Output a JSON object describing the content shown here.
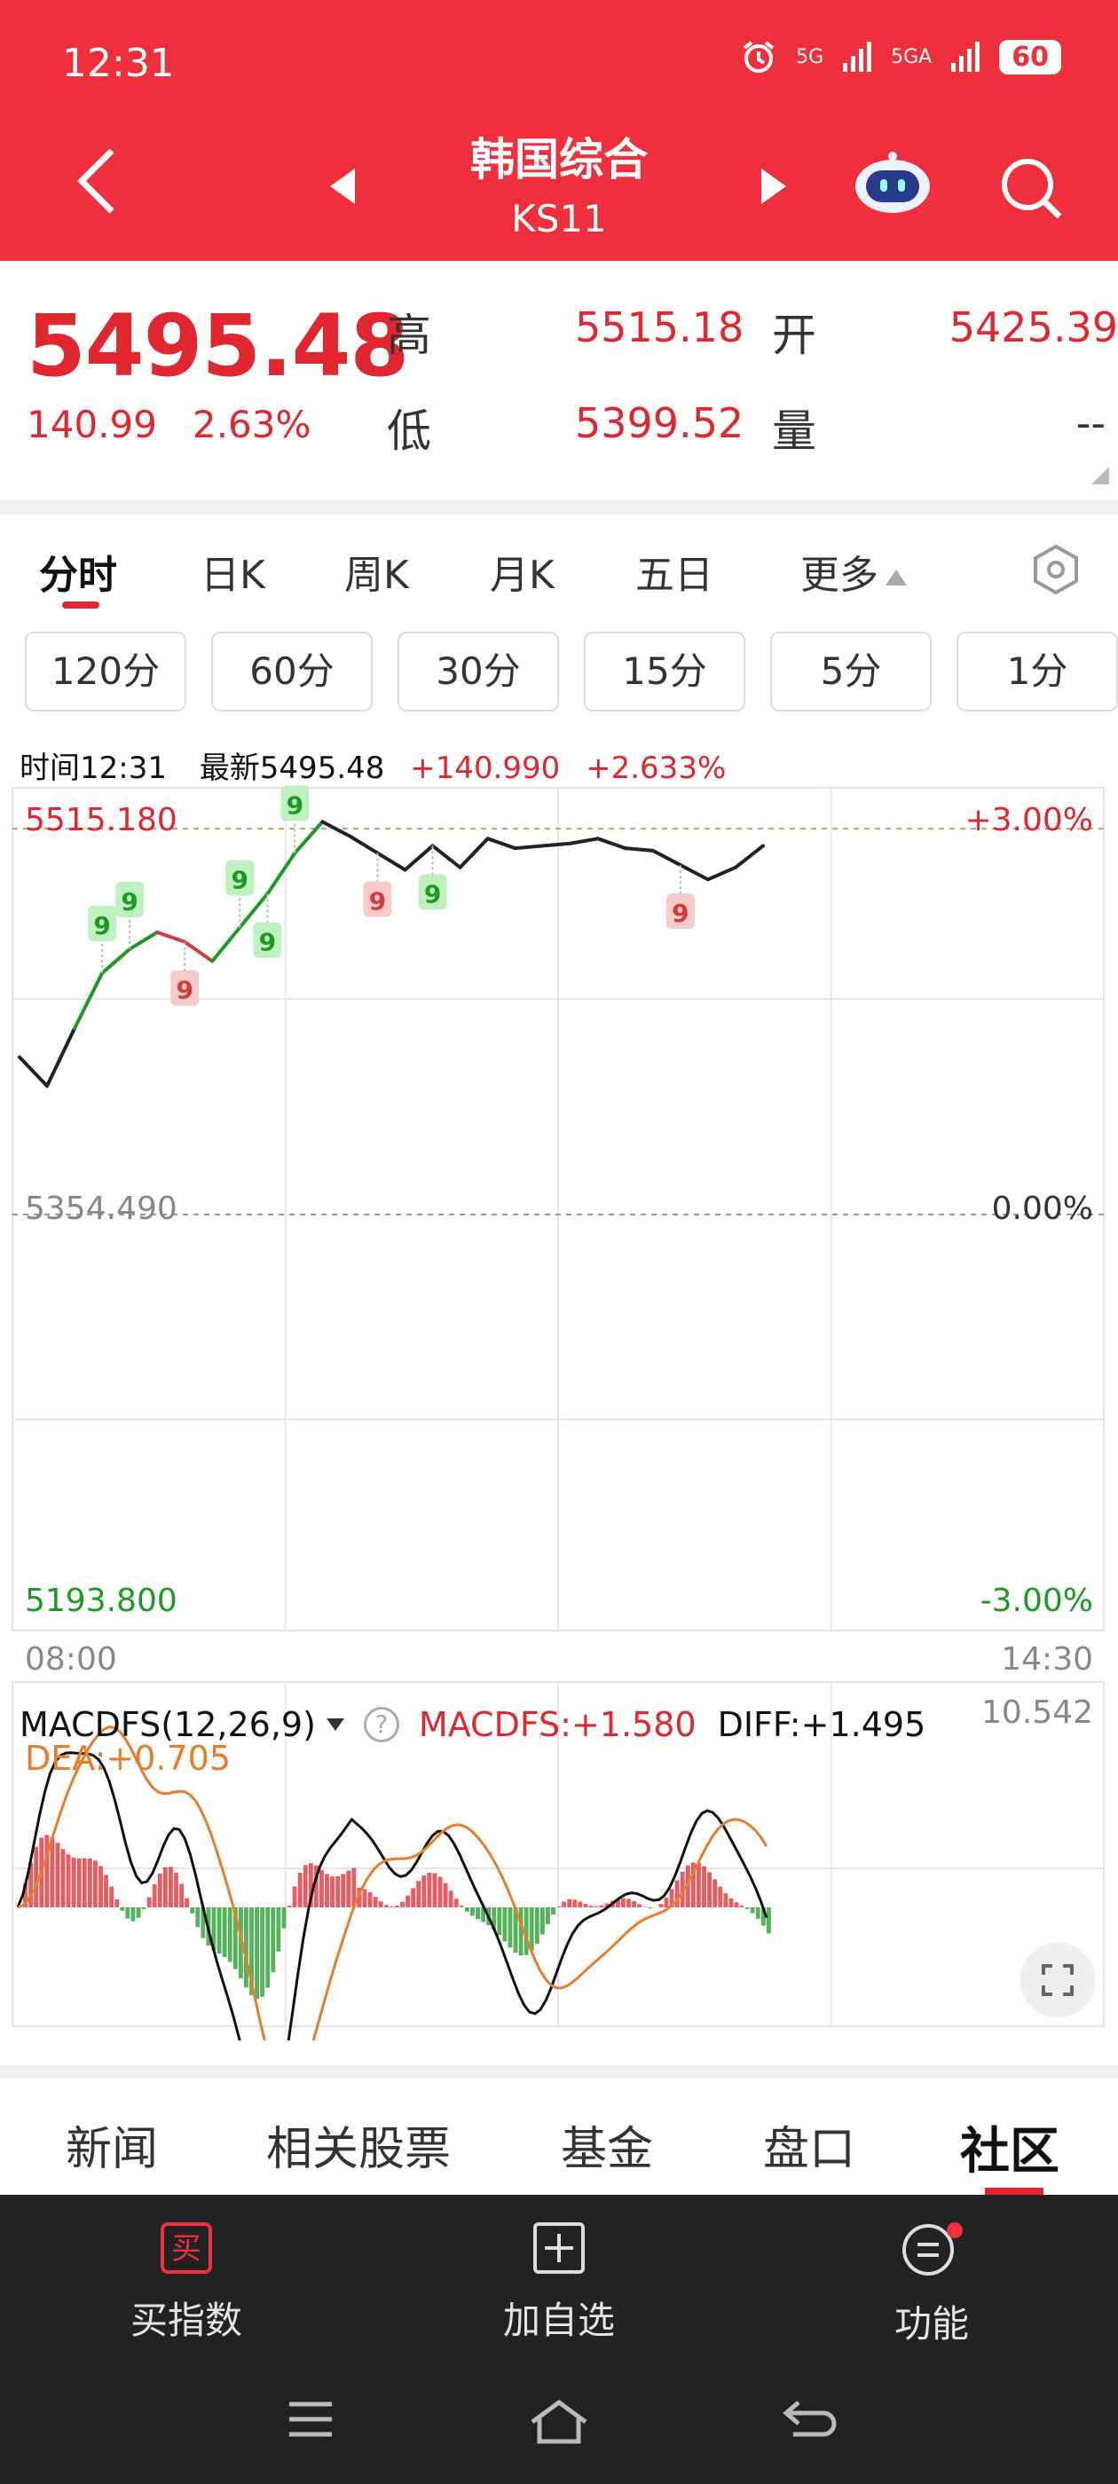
{
  "status": {
    "time": "12:31",
    "net1": "5G",
    "net2": "5GA",
    "battery": "60"
  },
  "header": {
    "title": "韩国综合",
    "code": "KS11"
  },
  "quote": {
    "price": "5495.48",
    "change": "140.99",
    "change_pct": "2.63%",
    "high_label": "高",
    "high": "5515.18",
    "open_label": "开",
    "open": "5425.39",
    "low_label": "低",
    "low": "5399.52",
    "volume_label": "量",
    "volume": "--"
  },
  "tabs": [
    "分时",
    "日K",
    "周K",
    "月K",
    "五日",
    "更多"
  ],
  "periods": [
    "120分",
    "60分",
    "30分",
    "15分",
    "5分",
    "1分"
  ],
  "info": {
    "time": "时间12:31",
    "latest": "最新5495.48",
    "change": "+140.990",
    "change_pct": "+2.633%"
  },
  "chart": {
    "y_top": "5515.180",
    "y_mid": "5354.490",
    "y_bot": "5193.800",
    "pct_top": "+3.00%",
    "pct_mid": "0.00%",
    "pct_bot": "-3.00%",
    "x_start": "08:00",
    "x_end": "14:30",
    "signal_marker": "9"
  },
  "macd": {
    "name": "MACDFS(12,26,9)",
    "help": "?",
    "macdfs": "MACDFS:+1.580",
    "diff": "DIFF:+1.495",
    "dea": "DEA:+0.705",
    "max": "10.542"
  },
  "bottom_tabs": [
    "新闻",
    "相关股票",
    "基金",
    "盘口",
    "社区"
  ],
  "actions": {
    "buy_icon": "买",
    "buy": "买指数",
    "add": "加自选",
    "func": "功能"
  },
  "colors": {
    "brand": "#ef2f3b",
    "up": "#e0262f",
    "down": "#1c9a24",
    "dea": "#e87e2c"
  },
  "chart_data": {
    "type": "line",
    "x_range": [
      "08:00",
      "14:30"
    ],
    "ylim": [
      5193.8,
      5515.18
    ],
    "base": 5354.49,
    "x": [
      "08:00",
      "08:10",
      "08:20",
      "08:30",
      "08:40",
      "08:50",
      "09:00",
      "09:10",
      "09:20",
      "09:30",
      "09:40",
      "09:50",
      "10:00",
      "10:10",
      "10:20",
      "10:30",
      "10:40",
      "10:50",
      "11:00",
      "11:10",
      "11:20",
      "11:30",
      "11:40",
      "11:50",
      "12:00",
      "12:10",
      "12:20",
      "12:30"
    ],
    "series": [
      {
        "values": [
          5420,
          5408,
          5432,
          5455,
          5465,
          5472,
          5468,
          5460,
          5474,
          5488,
          5505,
          5518,
          5512,
          5505,
          5498,
          5508,
          5499,
          5511,
          5507,
          5508,
          5509,
          5511,
          5507,
          5506,
          5500,
          5494,
          5499,
          5508
        ]
      }
    ]
  }
}
